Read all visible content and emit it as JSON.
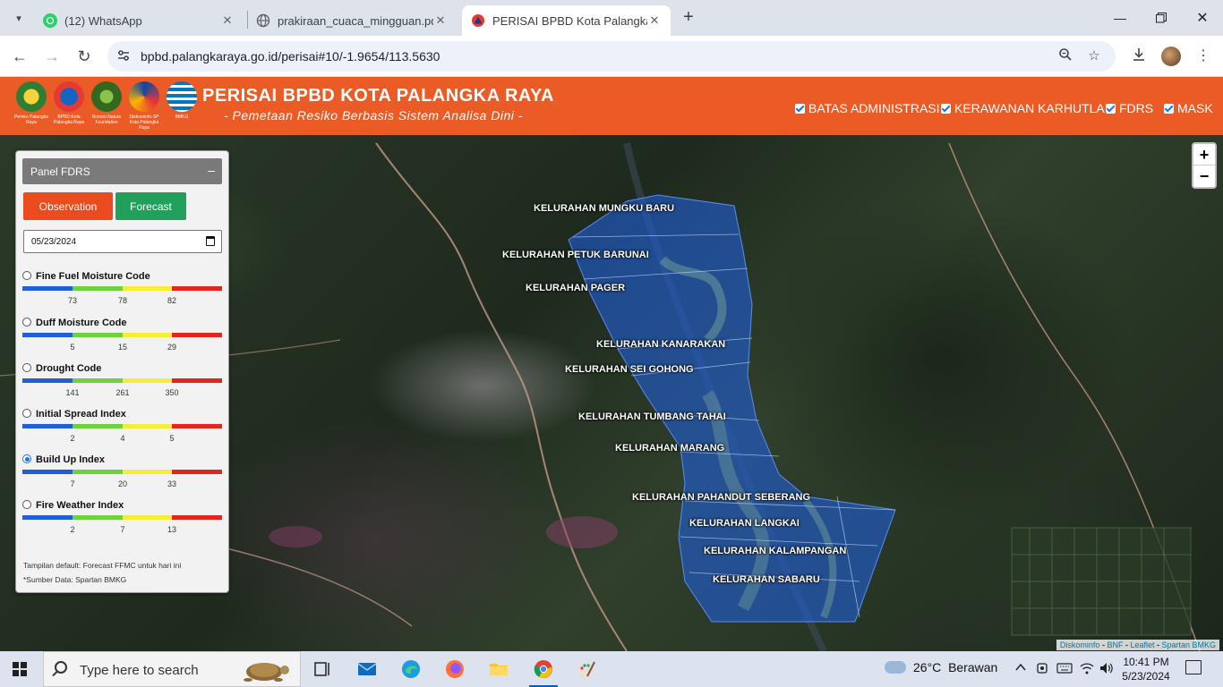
{
  "browser": {
    "tabs": [
      {
        "title": "(12) WhatsApp",
        "favicon": "whatsapp-icon"
      },
      {
        "title": "prakiraan_cuaca_mingguan.pdf",
        "favicon": "globe-icon"
      },
      {
        "title": "PERISAI BPBD Kota Palangka Ra",
        "favicon": "bpbd-icon"
      }
    ],
    "url": "bpbd.palangkaraya.go.id/perisai#10/-1.9654/113.5630"
  },
  "header": {
    "title": "PERISAI BPBD KOTA PALANGKA RAYA",
    "subtitle": "- Pemetaan Resiko Berbasis Sistem Analisa Dini -",
    "logos": [
      {
        "caption": "Pemko Palangka Raya",
        "color": "#2e7d32"
      },
      {
        "caption": "BPBD Kota Palangka Raya",
        "color": "#1565c0"
      },
      {
        "caption": "Borneo Nature Foundation",
        "color": "#33691e"
      },
      {
        "caption": "Diskominfo-SP Kota Palangka Raya",
        "color": "#0d47a1"
      },
      {
        "caption": "BMKG",
        "color": "#0277bd"
      }
    ],
    "layers": [
      "BATAS ADMINISTRASI",
      "KERAWANAN KARHUTLA",
      "FDRS",
      "MASK"
    ]
  },
  "panel": {
    "title": "Panel FDRS",
    "minimize": "–",
    "observation_label": "Observation",
    "forecast_label": "Forecast",
    "date": "05/23/2024",
    "indices": [
      {
        "name": "Fine Fuel Moisture Code",
        "ticks": [
          "73",
          "78",
          "82"
        ],
        "selected": false
      },
      {
        "name": "Duff Moisture Code",
        "ticks": [
          "5",
          "15",
          "29"
        ],
        "selected": false
      },
      {
        "name": "Drought Code",
        "ticks": [
          "141",
          "261",
          "350"
        ],
        "selected": false
      },
      {
        "name": "Initial Spread Index",
        "ticks": [
          "2",
          "4",
          "5"
        ],
        "selected": false
      },
      {
        "name": "Build Up Index",
        "ticks": [
          "7",
          "20",
          "33"
        ],
        "selected": true
      },
      {
        "name": "Fire Weather Index",
        "ticks": [
          "2",
          "7",
          "13"
        ],
        "selected": false
      }
    ],
    "scale_colors": [
      "#1f5fd9",
      "#6fd23c",
      "#f6ee36",
      "#e2261d"
    ],
    "note1": "Tampilan default: Forecast FFMC untuk hari ini",
    "note2": "*Sumber Data: Spartan BMKG"
  },
  "map": {
    "kelurahan": [
      "KELURAHAN MUNGKU BARU",
      "KELURAHAN PETUK BARUNAI",
      "KELURAHAN PAGER",
      "KELURAHAN KANARAKAN",
      "KELURAHAN SEI GOHONG",
      "KELURAHAN TUMBANG TAHAI",
      "KELURAHAN MARANG",
      "KELURAHAN PAHANDUT SEBERANG",
      "KELURAHAN LANGKAI",
      "KELURAHAN KALAMPANGAN",
      "KELURAHAN SABARU"
    ],
    "zoom_in": "+",
    "zoom_out": "−",
    "attribution": [
      "Diskominfo",
      "BNF",
      "Leaflet",
      "Spartan BMKG"
    ],
    "attribution_sep": " - ",
    "fdrs_fill": "#1f5fd9"
  },
  "taskbar": {
    "search_placeholder": "Type here to search",
    "weather_temp": "26°C",
    "weather_desc": "Berawan",
    "time": "10:41 PM",
    "date": "5/23/2024"
  }
}
